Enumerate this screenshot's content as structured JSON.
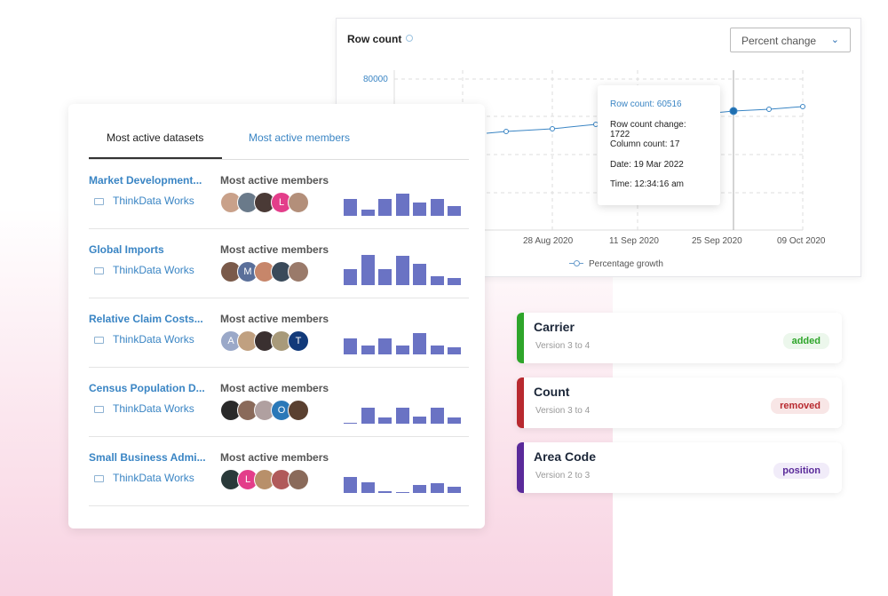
{
  "chart_card": {
    "title": "Row count",
    "select_value": "Percent change",
    "y_tick": "80000",
    "x_ticks": [
      "28 Aug 2020",
      "11 Sep 2020",
      "25 Sep 2020",
      "09 Oct 2020"
    ],
    "legend": "Percentage growth",
    "tooltip": {
      "row_count": "Row count: 60516",
      "row_count_change": "Row count change: 1722",
      "column_count": "Column count: 17",
      "date": "Date: 19 Mar 2022",
      "time": "Time: 12:34:16 am"
    },
    "line_color": "#3a85c4"
  },
  "datasets_card": {
    "tabs": [
      {
        "label": "Most active datasets",
        "active": true
      },
      {
        "label": "Most active members",
        "active": false
      }
    ],
    "rows": [
      {
        "name": "Market Development...",
        "org": "ThinkData Works",
        "members_label": "Most active members",
        "avatars": [
          "",
          "",
          "",
          "L",
          ""
        ],
        "activity": [
          19,
          7,
          19,
          25,
          15,
          19,
          11
        ]
      },
      {
        "name": "Global Imports",
        "org": "ThinkData Works",
        "members_label": "Most active members",
        "avatars": [
          "",
          "M",
          "",
          "",
          ""
        ],
        "activity": [
          18,
          34,
          18,
          33,
          24,
          10,
          8
        ]
      },
      {
        "name": "Relative Claim Costs...",
        "org": "ThinkData Works",
        "members_label": "Most active members",
        "avatars": [
          "A",
          "",
          "",
          "",
          "T"
        ],
        "activity": [
          18,
          10,
          18,
          10,
          24,
          10,
          8
        ]
      },
      {
        "name": "Census Population D...",
        "org": "ThinkData Works",
        "members_label": "Most active members",
        "avatars": [
          "",
          "",
          "",
          "O",
          ""
        ],
        "activity": [
          1,
          18,
          7,
          18,
          8,
          18,
          7
        ]
      },
      {
        "name": "Small Business Admi...",
        "org": "ThinkData Works",
        "members_label": "Most active members",
        "avatars": [
          "",
          "L",
          "",
          "",
          ""
        ],
        "activity": [
          18,
          12,
          2,
          1,
          9,
          11,
          7
        ]
      }
    ]
  },
  "changes": [
    {
      "name": "Carrier",
      "version": "Version 3 to 4",
      "badge": "added",
      "color": "#2ea52a",
      "badge_bg": "#ecf7ec"
    },
    {
      "name": "Count",
      "version": "Version 3 to 4",
      "badge": "removed",
      "color": "#b8292f",
      "badge_bg": "#f8e6e6"
    },
    {
      "name": "Area Code",
      "version": "Version 2 to 3",
      "badge": "position",
      "color": "#5a2a9a",
      "badge_bg": "#f1ecf9"
    }
  ]
}
